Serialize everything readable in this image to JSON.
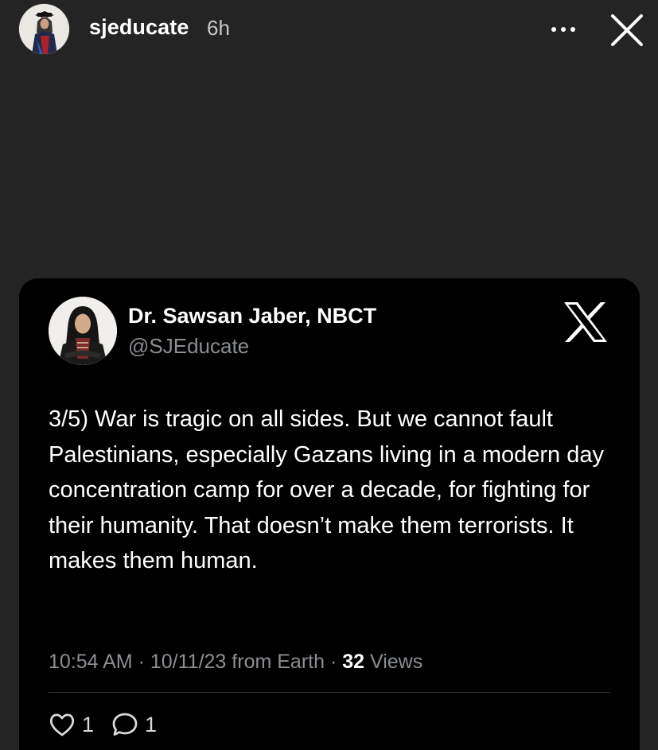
{
  "story": {
    "username": "sjeducate",
    "time_ago": "6h",
    "more_icon": "more-horizontal-icon",
    "close_icon": "close-icon"
  },
  "tweet": {
    "display_name": "Dr. Sawsan Jaber, NBCT",
    "handle": "@SJEducate",
    "platform_icon": "x-logo-icon",
    "text": "3/5) War is tragic on all sides.  But we cannot fault Palestinians, especially Gazans living in a modern day concentration camp for over a decade, for fighting for their humanity. That doesn’t make them terrorists. It makes them human.",
    "time": "10:54 AM",
    "date": "10/11/23",
    "source": "from Earth",
    "views_count": "32",
    "views_label": "Views",
    "likes": "1",
    "replies": "1"
  },
  "colors": {
    "story_background": "#242424",
    "card_background": "#000000",
    "secondary_text": "#8b8e92",
    "primary_text": "#ffffff"
  }
}
